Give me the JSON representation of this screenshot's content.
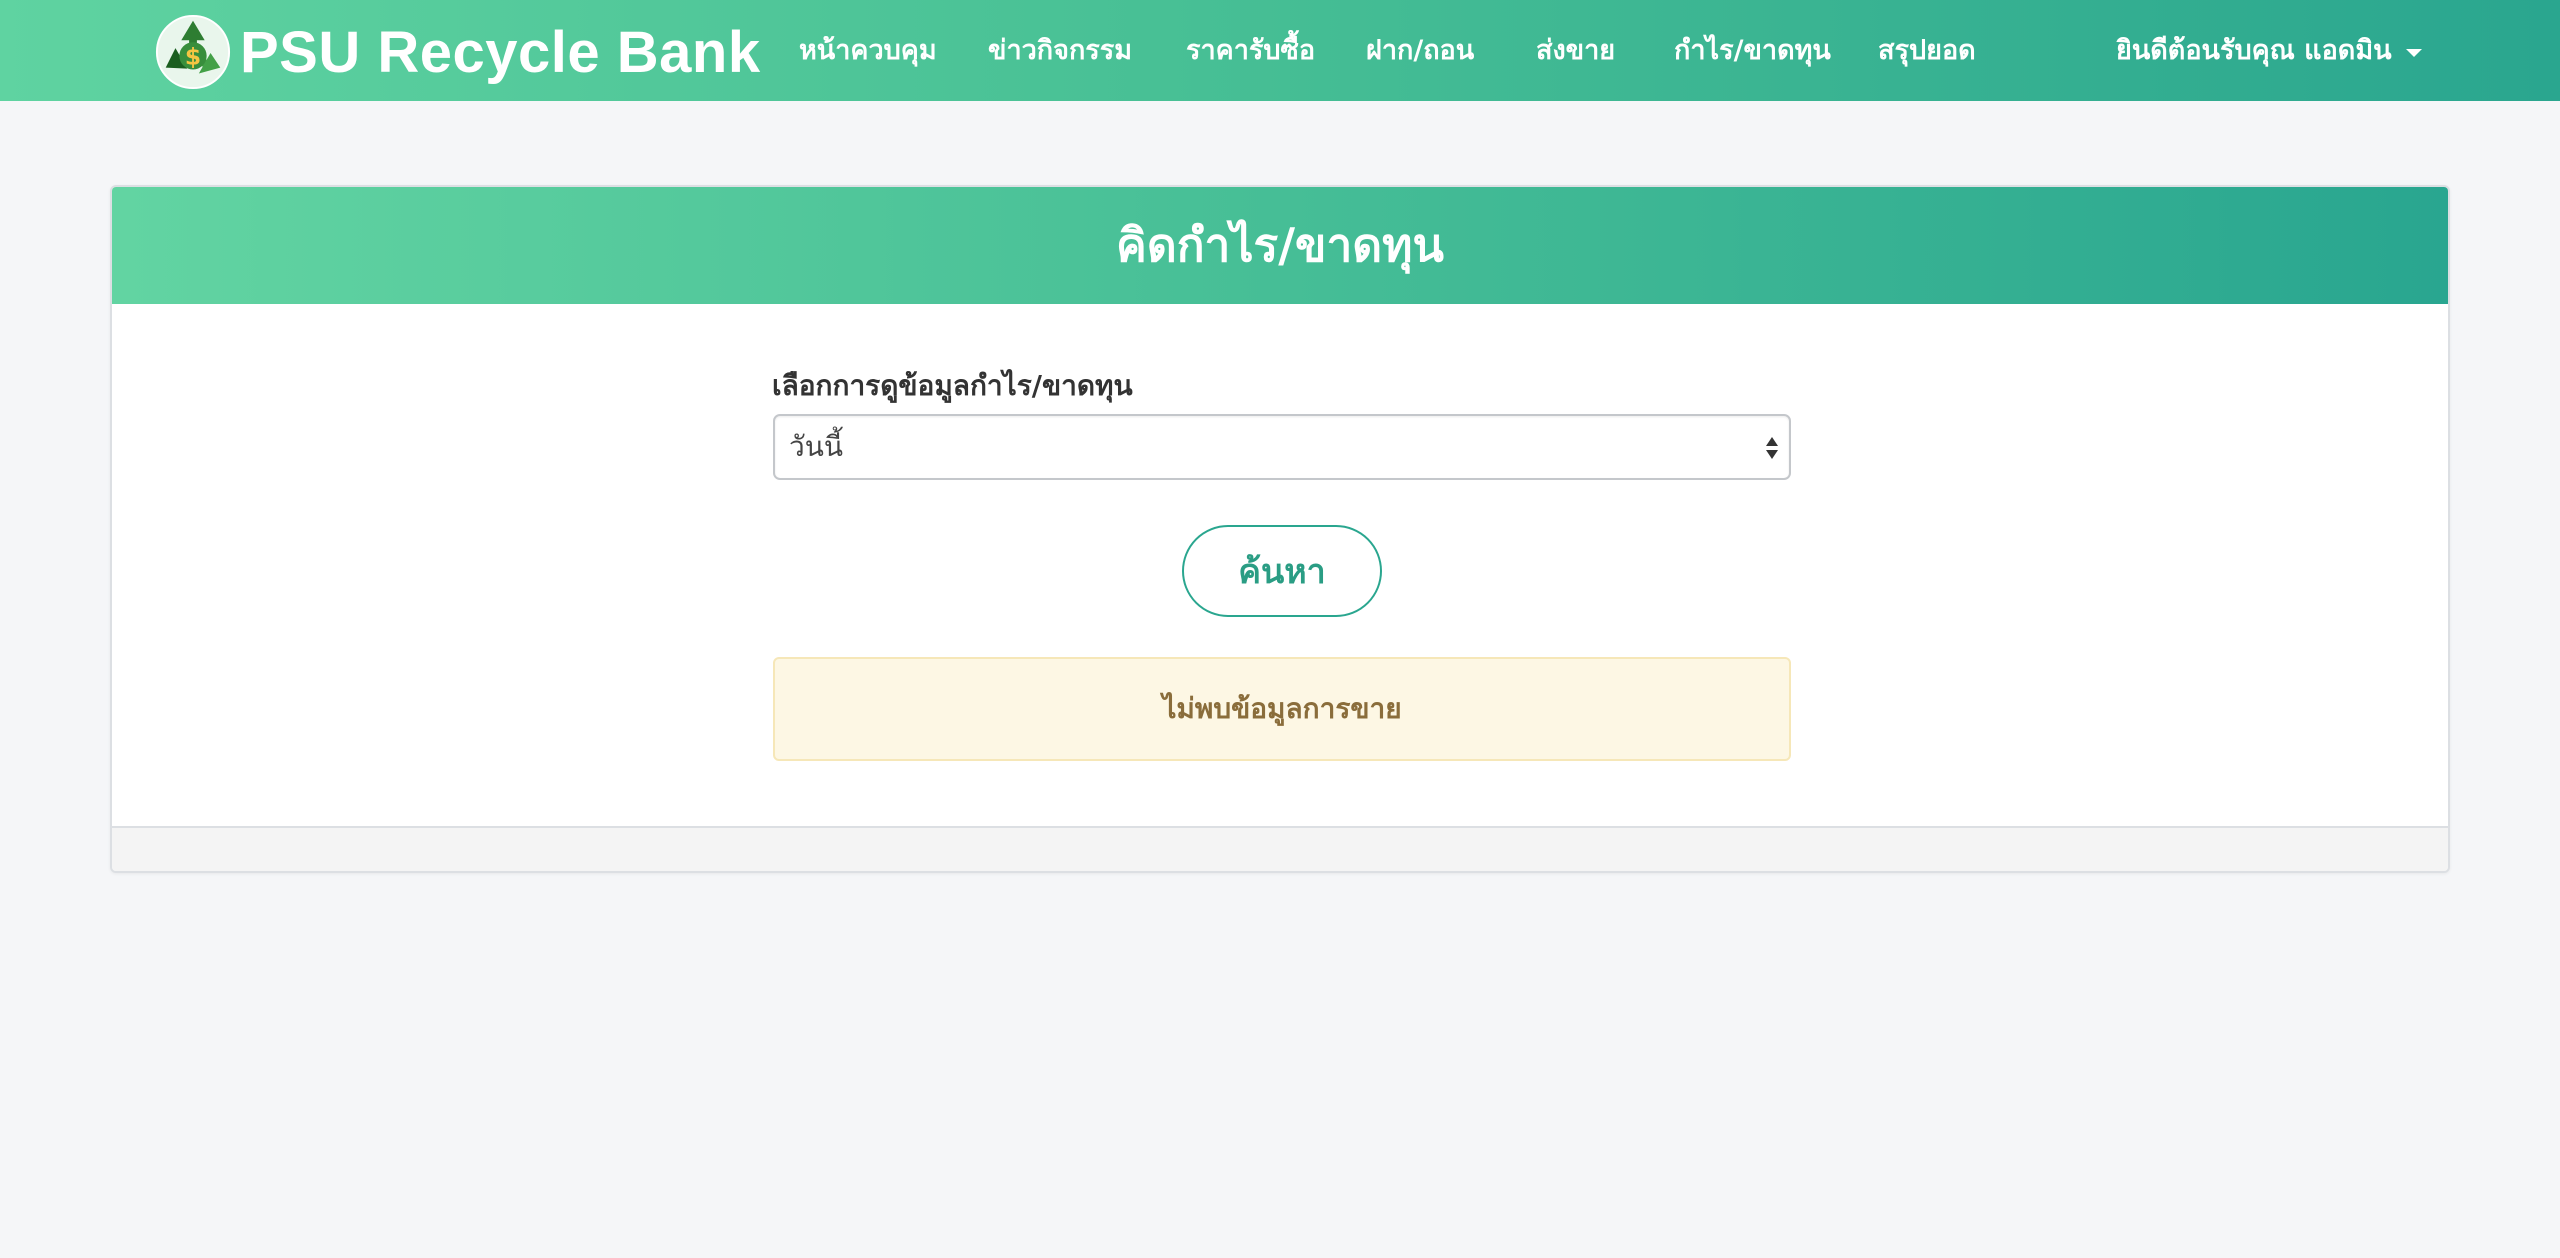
{
  "brand": {
    "name": "PSU Recycle Bank",
    "logo_icon": "recycle-money-icon"
  },
  "nav": {
    "items": [
      {
        "label": "หน้าควบคุม"
      },
      {
        "label": "ข่าวกิจกรรม"
      },
      {
        "label": "ราคารับซื้อ"
      },
      {
        "label": "ฝาก/ถอน"
      },
      {
        "label": "ส่งขาย"
      },
      {
        "label": "กำไร/ขาดทุน"
      },
      {
        "label": "สรุปยอด"
      }
    ],
    "user_greeting": "ยินดีต้อนรับคุณ แอดมิน"
  },
  "panel": {
    "title": "คิดกำไร/ขาดทุน",
    "form": {
      "label": "เลือกการดูข้อมูลกำไร/ขาดทุน",
      "selected_value": "วันนี้"
    },
    "search_button": "ค้นหา",
    "alert_message": "ไม่พบข้อมูลการขาย"
  },
  "colors": {
    "brand_green_light": "#5fd3a1",
    "brand_green_dark": "#2aa68f",
    "alert_background": "#fdf7e4",
    "alert_text": "#8a6d3b",
    "page_background": "#f5f6f8"
  }
}
